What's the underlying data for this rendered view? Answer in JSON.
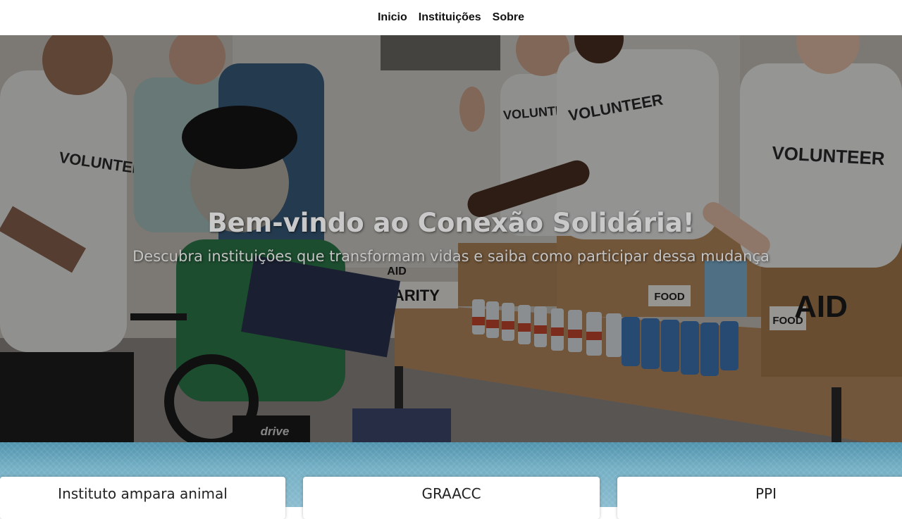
{
  "nav": {
    "items": [
      {
        "label": "Inicio"
      },
      {
        "label": "Instituições"
      },
      {
        "label": "Sobre"
      }
    ]
  },
  "hero": {
    "title": "Bem-vindo ao Conexão Solidária!",
    "subtitle": "Descubra instituições que transformam vidas e saiba como participar dessa mudança",
    "image_texts": {
      "shirt_1": "VOLUNTEER",
      "shirt_2": "VOLUNTEER",
      "shirt_3": "VOLUNTEER",
      "shirt_4": "VOLUNTEER",
      "box_aid_1": "AID",
      "box_aid_2": "AID",
      "box_food_1": "FOOD",
      "box_food_2": "FOOD",
      "sign_charity": "CHARITY",
      "wheelchair_brand": "drive"
    }
  },
  "cards": [
    {
      "title": "Instituto ampara animal"
    },
    {
      "title": "GRAACC"
    },
    {
      "title": "PPI"
    }
  ],
  "colors": {
    "nav_bg": "#ffffff",
    "band": "#74afc4",
    "card_bg": "#ffffff"
  }
}
